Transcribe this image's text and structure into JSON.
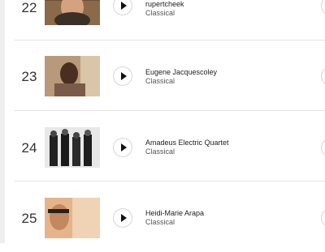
{
  "tracks": [
    {
      "rank": "22",
      "title": "rupertcheek",
      "genre": "Classical",
      "thumb_icon": "artist-photo",
      "play_icon": "play-icon"
    },
    {
      "rank": "23",
      "title": "Eugene Jacquescoley",
      "genre": "Classical",
      "thumb_icon": "artist-photo",
      "play_icon": "play-icon"
    },
    {
      "rank": "24",
      "title": "Amadeus Electric Quartet",
      "genre": "Classical",
      "thumb_icon": "artist-photo",
      "play_icon": "play-icon"
    },
    {
      "rank": "25",
      "title": "Heidi-Marie Arapa",
      "genre": "Classical",
      "thumb_icon": "artist-photo",
      "play_icon": "play-icon"
    }
  ],
  "colors": {
    "divider": "#e4e4e4",
    "text": "#222222",
    "subtext": "#555555"
  }
}
